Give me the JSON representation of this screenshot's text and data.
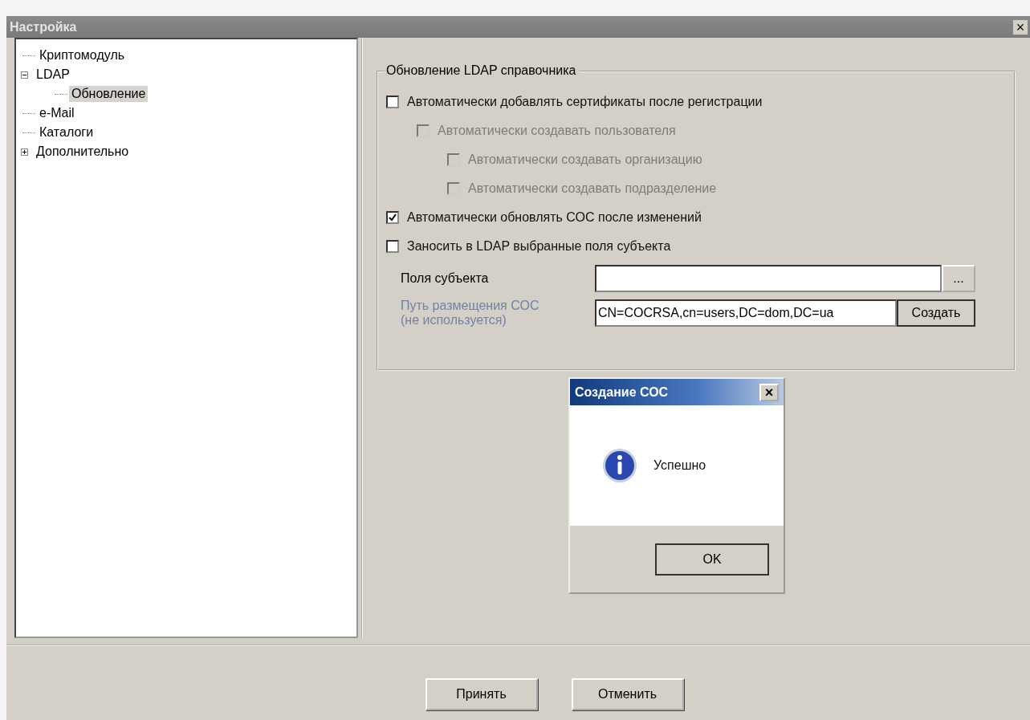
{
  "window": {
    "title": "Настройка",
    "close": "×"
  },
  "tree": [
    {
      "label": "Криптомодуль",
      "selected": false
    },
    {
      "label": "LDAP",
      "selected": false,
      "expanded": true,
      "children": [
        {
          "label": "Обновление",
          "selected": true
        }
      ]
    },
    {
      "label": "e-Mail",
      "selected": false
    },
    {
      "label": "Каталоги",
      "selected": false
    },
    {
      "label": "Дополнительно",
      "selected": false,
      "expanded": false
    }
  ],
  "group": {
    "title": "Обновление LDAP справочника",
    "options": [
      {
        "label": "Автоматически добавлять сертификаты после регистрации",
        "checked": false,
        "disabled": false,
        "children": [
          {
            "label": "Автоматически создавать пользователя",
            "checked": false,
            "disabled": true,
            "children": [
              {
                "label": "Автоматически создавать организацию",
                "checked": false,
                "disabled": true
              },
              {
                "label": "Автоматически создавать подразделение",
                "checked": false,
                "disabled": true
              }
            ]
          }
        ]
      },
      {
        "label": "Автоматически обновлять СОС после изменений",
        "checked": true,
        "disabled": false
      },
      {
        "label": "Заносить в LDAP выбранные поля субъекта",
        "checked": false,
        "disabled": false
      }
    ],
    "fields": [
      {
        "label": "Поля субъекта",
        "disabled": false,
        "button": "..."
      },
      {
        "label": "Путь размещения СОС (не используется)",
        "disabled": true,
        "value": "CN=COCRSA,cn=users,DC=dom,DC=ua",
        "button": "Создать"
      }
    ]
  },
  "dialog": {
    "title": "Создание СОС",
    "close": "×",
    "message": "Успешно",
    "button": "OK"
  },
  "buttons": [
    "Принять",
    "Отменить"
  ]
}
